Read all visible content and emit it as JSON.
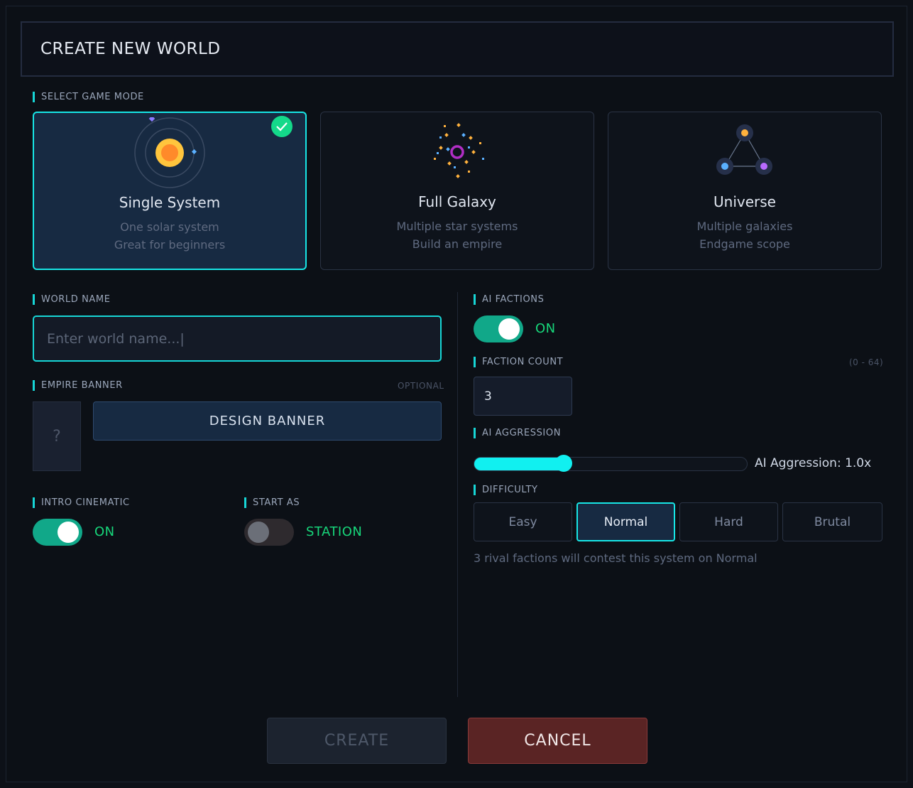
{
  "header": {
    "title": "CREATE NEW WORLD"
  },
  "game_mode": {
    "label": "SELECT GAME MODE",
    "cards": [
      {
        "title": "Single System",
        "line1": "One solar system",
        "line2": "Great for beginners",
        "selected": true
      },
      {
        "title": "Full Galaxy",
        "line1": "Multiple star systems",
        "line2": "Build an empire",
        "selected": false
      },
      {
        "title": "Universe",
        "line1": "Multiple galaxies",
        "line2": "Endgame scope",
        "selected": false
      }
    ]
  },
  "world_name": {
    "label": "WORLD NAME",
    "placeholder": "Enter world name...|",
    "value": ""
  },
  "empire_banner": {
    "label": "EMPIRE BANNER",
    "optional": "OPTIONAL",
    "preview": "?",
    "button": "DESIGN BANNER"
  },
  "intro_cinematic": {
    "label": "INTRO CINEMATIC",
    "state": "ON",
    "on": true
  },
  "start_as": {
    "label": "START AS",
    "state": "STATION",
    "on": false
  },
  "ai_factions": {
    "label": "AI FACTIONS",
    "state": "ON",
    "on": true
  },
  "faction_count": {
    "label": "FACTION COUNT",
    "range": "(0 - 64)",
    "value": "3"
  },
  "ai_aggression": {
    "label": "AI AGGRESSION",
    "readout": "AI Aggression: 1.0x",
    "level": 0.33
  },
  "difficulty": {
    "label": "DIFFICULTY",
    "options": [
      "Easy",
      "Normal",
      "Hard",
      "Brutal"
    ],
    "selected": "Normal",
    "summary": "3 rival factions will contest this system on Normal"
  },
  "actions": {
    "create": "CREATE",
    "cancel": "CANCEL"
  },
  "colors": {
    "accent": "#17e6e6",
    "toggle_on": "#11a889",
    "on_text": "#17d67a",
    "cancel": "#5a2424",
    "selected_card": "#172a42"
  }
}
